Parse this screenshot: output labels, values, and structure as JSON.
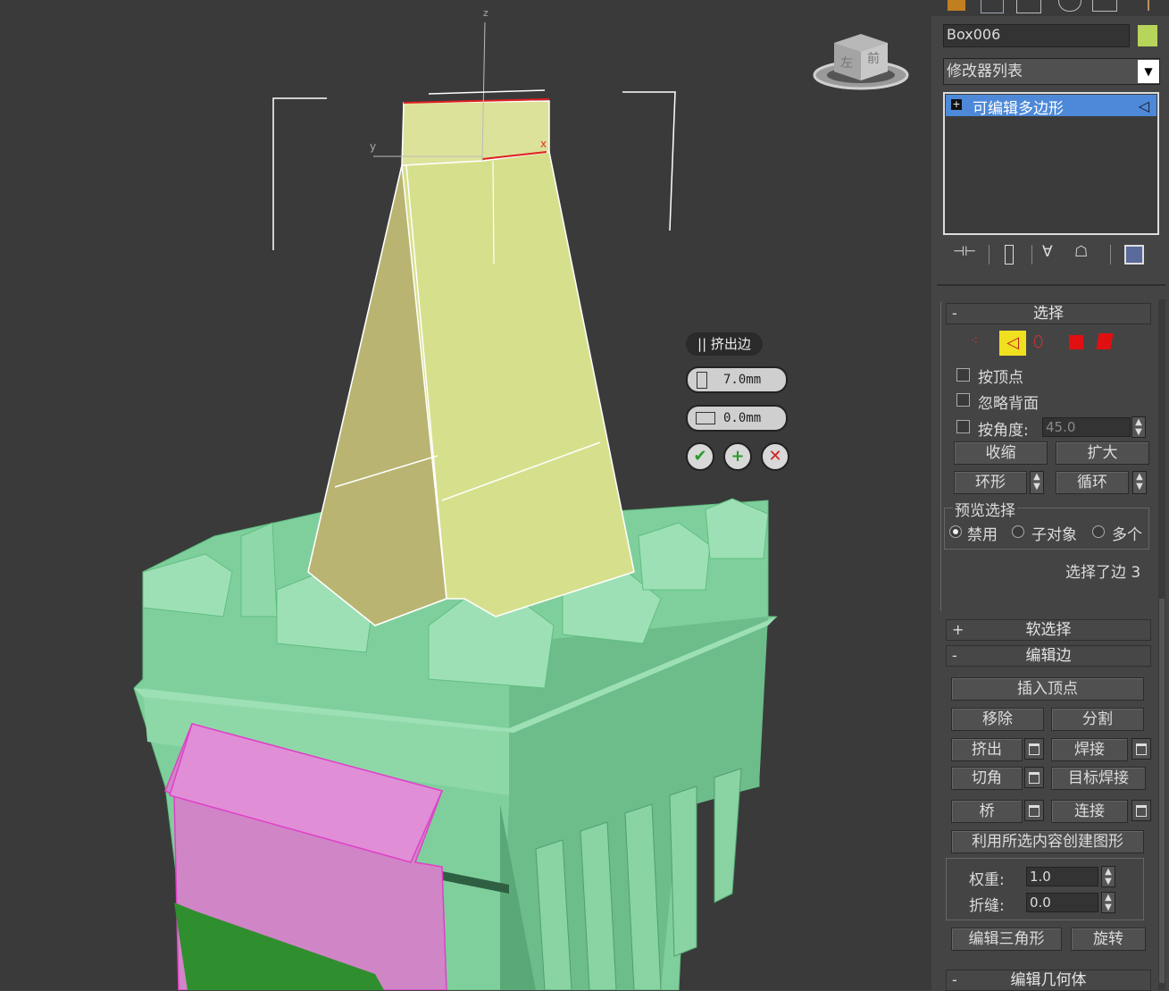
{
  "viewport": {
    "axis_labels": {
      "z": "z",
      "y": "y",
      "x": "x"
    },
    "viewcube": {
      "left": "左",
      "front": "前"
    },
    "caddy": {
      "title": "|| 挤出边",
      "height_value": "7.0mm",
      "width_value": "0.0mm",
      "ok_icon": "check-icon",
      "apply_icon": "plus-icon",
      "cancel_icon": "cross-icon"
    }
  },
  "panel": {
    "object_name": "Box006",
    "object_color": "#b7d55a",
    "modifier_list": "修改器列表",
    "stack_item": "可编辑多边形",
    "select_rollout": {
      "title": "选择",
      "by_vertex": "按顶点",
      "ignore_backfacing": "忽略背面",
      "by_angle": "按角度:",
      "angle_value": "45.0",
      "shrink": "收缩",
      "grow": "扩大",
      "ring": "环形",
      "loop": "循环",
      "preview_group": "预览选择",
      "preview_options": [
        "禁用",
        "子对象",
        "多个"
      ],
      "status": "选择了边 3"
    },
    "soft_select": {
      "title": "软选择"
    },
    "edit_edges": {
      "title": "编辑边",
      "insert_vertex": "插入顶点",
      "remove": "移除",
      "split": "分割",
      "extrude": "挤出",
      "weld": "焊接",
      "chamfer": "切角",
      "target_weld": "目标焊接",
      "bridge": "桥",
      "connect": "连接",
      "create_shape": "利用所选内容创建图形",
      "weight_label": "权重:",
      "weight_value": "1.0",
      "crease_label": "折缝:",
      "crease_value": "0.0",
      "edit_tri": "编辑三角形",
      "turn": "旋转"
    },
    "edit_geometry": {
      "title": "编辑几何体"
    }
  }
}
